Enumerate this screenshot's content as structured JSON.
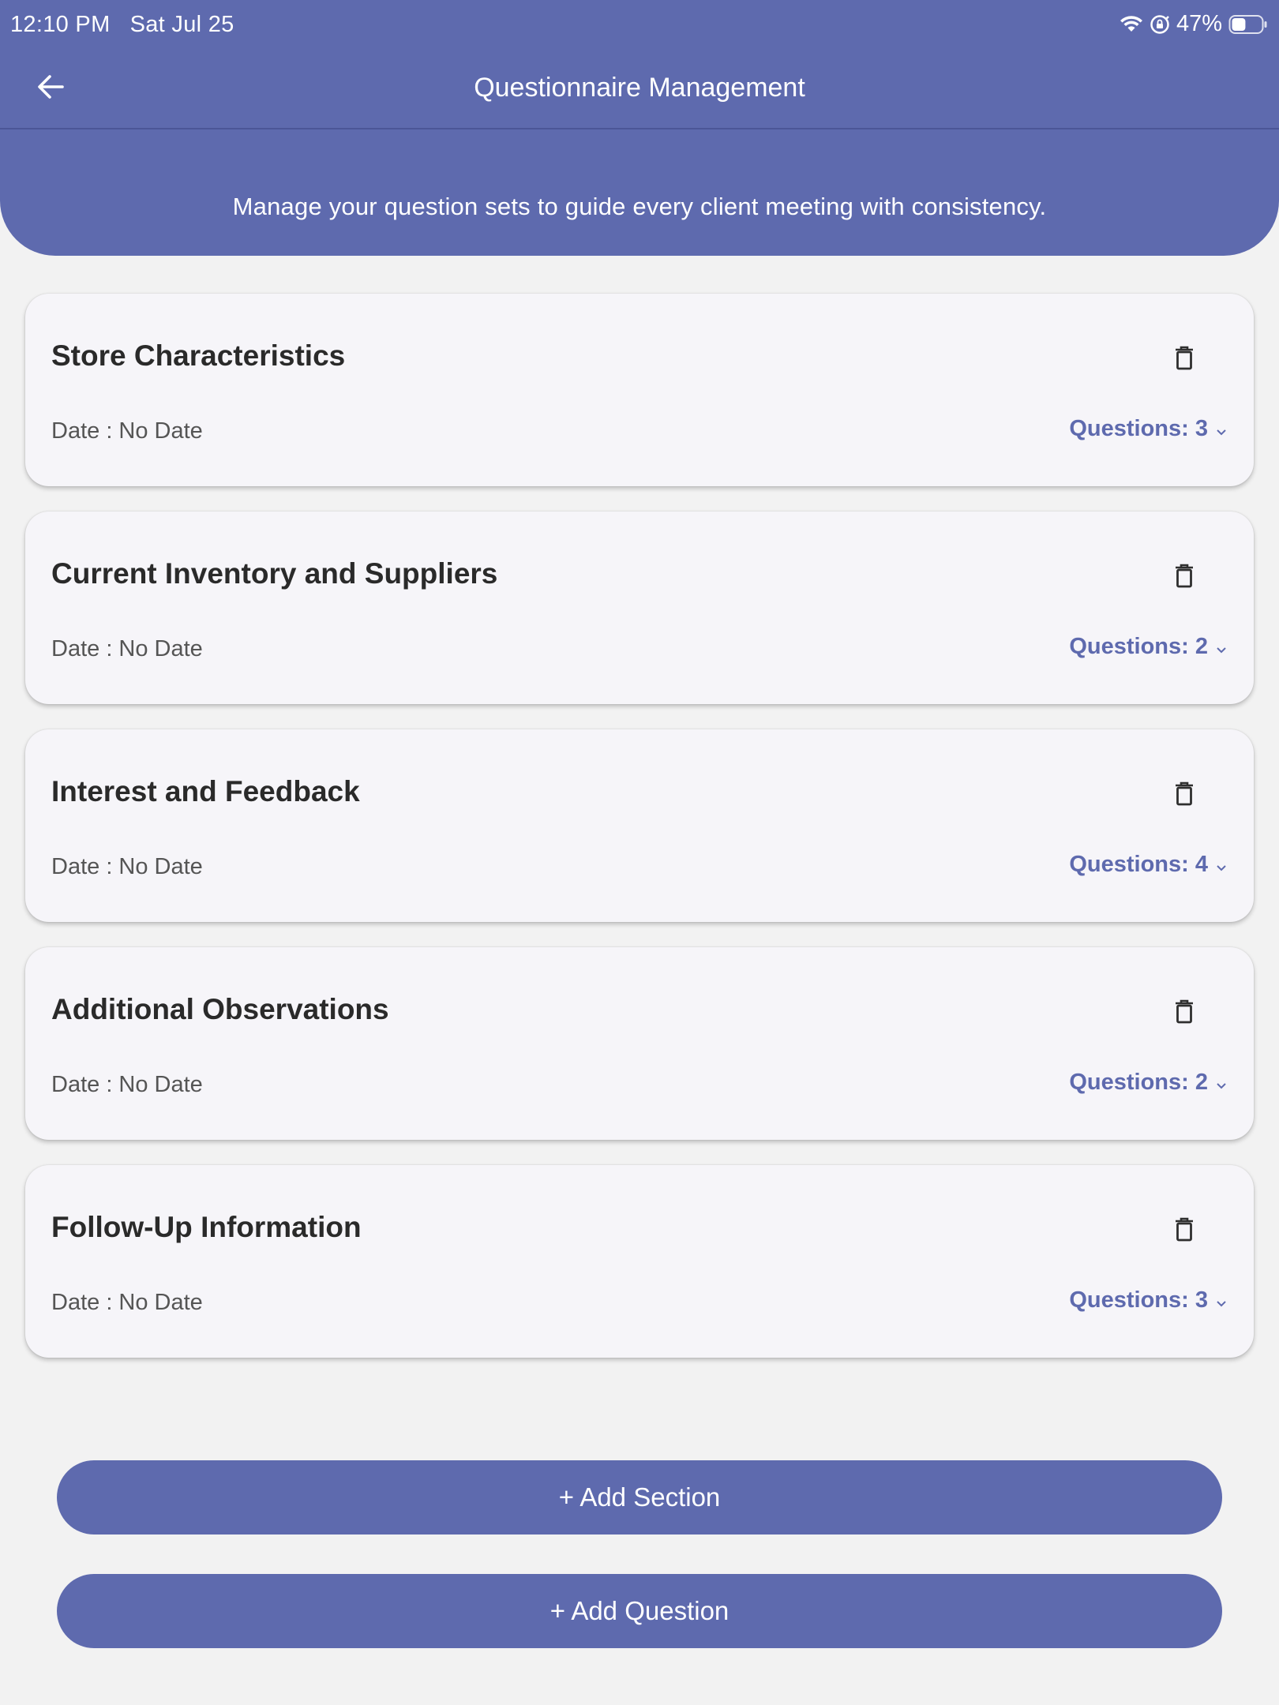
{
  "status_bar": {
    "time": "12:10 PM",
    "date": "Sat Jul 25",
    "battery": "47%",
    "battery_level": 0.47,
    "icons": [
      "wifi-icon",
      "orientation-lock-icon",
      "battery-icon"
    ]
  },
  "header": {
    "back_icon": "arrow-left-icon",
    "title": "Questionnaire Management",
    "subtitle": "Manage your question sets to guide every client meeting with consistency."
  },
  "sections": [
    {
      "title": "Store Characteristics",
      "date_label": "Date : No Date",
      "questions_label": "Questions: 3"
    },
    {
      "title": "Current Inventory and Suppliers",
      "date_label": "Date : No Date",
      "questions_label": "Questions: 2"
    },
    {
      "title": "Interest and Feedback",
      "date_label": "Date : No Date",
      "questions_label": "Questions: 4"
    },
    {
      "title": "Additional Observations",
      "date_label": "Date : No Date",
      "questions_label": "Questions: 2"
    },
    {
      "title": "Follow-Up Information",
      "date_label": "Date : No Date",
      "questions_label": "Questions: 3"
    }
  ],
  "actions": {
    "add_section": "+ Add Section",
    "add_question": "+ Add Question"
  },
  "colors": {
    "primary": "#5e6aae",
    "background": "#f2f2f2",
    "card": "#f6f5f9"
  }
}
